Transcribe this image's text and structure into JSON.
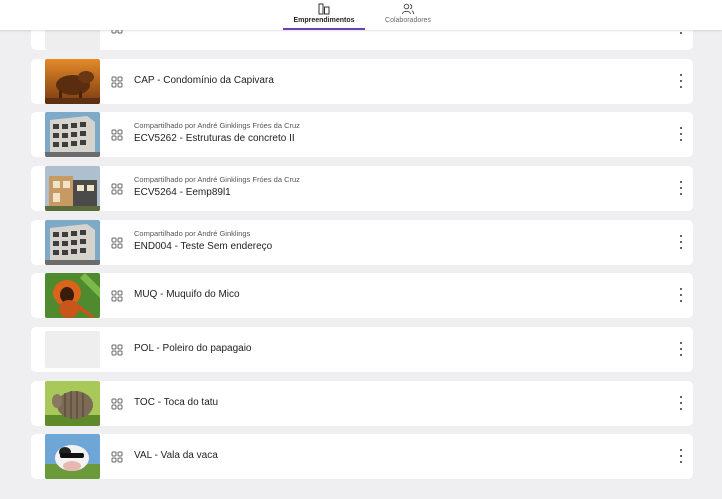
{
  "tabs": [
    {
      "label": "Empreendimentos",
      "icon": "buildings-icon",
      "active": true
    },
    {
      "label": "Colaboradores",
      "icon": "people-icon",
      "active": false
    }
  ],
  "accent_color": "#6a3fb5",
  "projects": [
    {
      "title": "",
      "shared_by": "",
      "image": "placeholder"
    },
    {
      "title": "CAP - Condomínio da Capivara",
      "shared_by": "",
      "image": "capybara"
    },
    {
      "title": "ECV5262 - Estruturas de concreto II",
      "shared_by": "Compartilhado por André Ginklings Fróes da Cruz",
      "image": "building"
    },
    {
      "title": "ECV5264 - Eemp89l1",
      "shared_by": "Compartilhado por André Ginklings Fróes da Cruz",
      "image": "house"
    },
    {
      "title": "END004 - Teste Sem endereço",
      "shared_by": "Compartilhado por André Ginklings",
      "image": "building"
    },
    {
      "title": "MUQ - Muquifo do Mico",
      "shared_by": "",
      "image": "monkey"
    },
    {
      "title": "POL - Poleiro do papagaio",
      "shared_by": "",
      "image": "placeholder"
    },
    {
      "title": "TOC - Toca do tatu",
      "shared_by": "",
      "image": "armadillo"
    },
    {
      "title": "VAL - Vala da vaca",
      "shared_by": "",
      "image": "cow"
    }
  ]
}
